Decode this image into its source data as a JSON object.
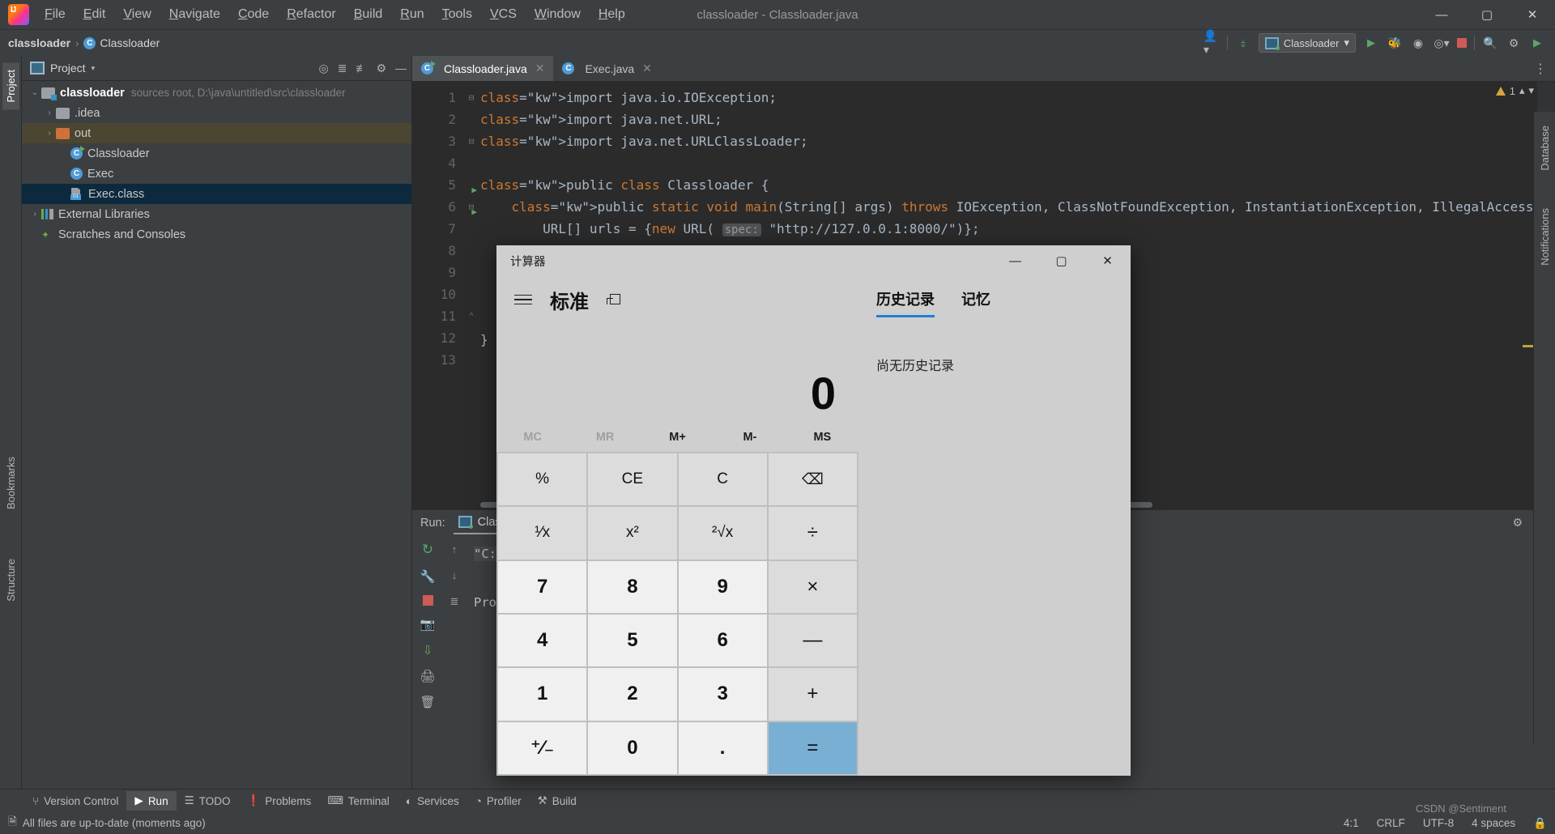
{
  "window": {
    "title": "classloader - Classloader.java",
    "menu": [
      "File",
      "Edit",
      "View",
      "Navigate",
      "Code",
      "Refactor",
      "Build",
      "Run",
      "Tools",
      "VCS",
      "Window",
      "Help"
    ],
    "controls": {
      "minimize": "—",
      "maximize": "▢",
      "close": "✕"
    }
  },
  "navbar": {
    "breadcrumb": [
      "classloader",
      "Classloader"
    ],
    "separator": "›",
    "run_config": "Classloader",
    "run_config_caret": "▾",
    "icons": [
      "user-dropdown-icon",
      "build-hammer-icon",
      "run-icon",
      "debug-icon",
      "coverage-icon",
      "profile-icon",
      "stop-icon",
      "search-icon",
      "settings-icon",
      "run-play-icon"
    ]
  },
  "left_rail": {
    "tabs": [
      "Project",
      "Bookmarks",
      "Structure"
    ]
  },
  "right_rail": {
    "tabs": [
      "Database",
      "Notifications"
    ]
  },
  "project": {
    "panel_title": "Project",
    "header_icons": [
      "locate-icon",
      "expand-all-icon",
      "collapse-all-icon",
      "gear-icon",
      "hide-icon"
    ],
    "tree": [
      {
        "indent": 0,
        "arrow": "⌄",
        "icon": "module-folder-icon",
        "label": "classloader",
        "bold": true,
        "detail": "sources root,  D:\\java\\untitled\\src\\classloader",
        "state": "normal"
      },
      {
        "indent": 1,
        "arrow": "›",
        "icon": "folder-icon",
        "label": ".idea",
        "bold": false,
        "detail": "",
        "state": "normal"
      },
      {
        "indent": 1,
        "arrow": "›",
        "icon": "folder-orange-icon",
        "label": "out",
        "bold": false,
        "detail": "",
        "state": "highlight"
      },
      {
        "indent": 2,
        "arrow": "",
        "icon": "java-class-run-icon",
        "label": "Classloader",
        "bold": false,
        "detail": "",
        "state": "normal"
      },
      {
        "indent": 2,
        "arrow": "",
        "icon": "java-class-icon",
        "label": "Exec",
        "bold": false,
        "detail": "",
        "state": "normal"
      },
      {
        "indent": 2,
        "arrow": "",
        "icon": "class-file-icon",
        "label": "Exec.class",
        "bold": false,
        "detail": "",
        "state": "selected"
      },
      {
        "indent": 0,
        "arrow": "›",
        "icon": "library-icon",
        "label": "External Libraries",
        "bold": false,
        "detail": "",
        "state": "normal"
      },
      {
        "indent": 0,
        "arrow": "",
        "icon": "scratches-icon",
        "label": "Scratches and Consoles",
        "bold": false,
        "detail": "",
        "state": "normal"
      }
    ]
  },
  "editor": {
    "tabs": [
      {
        "label": "Classloader.java",
        "icon": "java-class-run-icon",
        "active": true,
        "close": "✕"
      },
      {
        "label": "Exec.java",
        "icon": "java-class-icon",
        "active": false,
        "close": "✕"
      }
    ],
    "warning_count": "1",
    "warning_icon": "warning-triangle-icon",
    "lines": [
      {
        "n": "1",
        "fold": "⊟",
        "run": "",
        "text": "import java.io.IOException;"
      },
      {
        "n": "2",
        "fold": "",
        "run": "",
        "text": "import java.net.URL;"
      },
      {
        "n": "3",
        "fold": "⊟",
        "run": "",
        "text": "import java.net.URLClassLoader;"
      },
      {
        "n": "4",
        "fold": "",
        "run": "",
        "text": ""
      },
      {
        "n": "5",
        "fold": "",
        "run": "▶",
        "text": "public class Classloader {"
      },
      {
        "n": "6",
        "fold": "⊟",
        "run": "▶",
        "text": "    public static void main(String[] args) throws IOException, ClassNotFoundException, InstantiationException, IllegalAccessExcepti"
      },
      {
        "n": "7",
        "fold": "",
        "run": "",
        "text": "        URL[] urls = {new URL( spec: \"http://127.0.0.1:8000/\")};"
      },
      {
        "n": "8",
        "fold": "",
        "run": "",
        "text": ""
      },
      {
        "n": "9",
        "fold": "",
        "run": "",
        "text": ""
      },
      {
        "n": "10",
        "fold": "",
        "run": "",
        "text": ""
      },
      {
        "n": "11",
        "fold": "⌃",
        "run": "",
        "text": ""
      },
      {
        "n": "12",
        "fold": "",
        "run": "",
        "text": "}"
      },
      {
        "n": "13",
        "fold": "",
        "run": "",
        "text": ""
      }
    ],
    "param_hint": "spec:",
    "string_literal": "\"http://127.0.0.1:8000/\""
  },
  "run_panel": {
    "label": "Run:",
    "tab": "Classloader",
    "tab_close": "✕",
    "console": [
      "\"C:\\Program Files\\Java\\jdk1.8.0_251\\bin\\java.exe\"",
      "",
      "Process finished with exit code 0"
    ],
    "header_icons": [
      "settings-icon",
      "hide-icon"
    ],
    "rail_icons": [
      "rerun-icon",
      "wrench-icon",
      "stop-icon",
      "screenshot-icon",
      "scroll-down-icon",
      "print-icon",
      "trash-icon"
    ],
    "rail2_icons": [
      "up-arrow-icon",
      "down-arrow-icon",
      "soft-wrap-icon"
    ]
  },
  "tool_windows": [
    {
      "label": "Version Control",
      "icon": "branch-icon",
      "active": false
    },
    {
      "label": "Run",
      "icon": "play-icon",
      "active": true
    },
    {
      "label": "TODO",
      "icon": "list-icon",
      "active": false
    },
    {
      "label": "Problems",
      "icon": "exclamation-icon",
      "active": false
    },
    {
      "label": "Terminal",
      "icon": "terminal-icon",
      "active": false
    },
    {
      "label": "Services",
      "icon": "services-icon",
      "active": false
    },
    {
      "label": "Profiler",
      "icon": "profiler-icon",
      "active": false
    },
    {
      "label": "Build",
      "icon": "hammer-icon",
      "active": false
    }
  ],
  "status_bar": {
    "message": "All files are up-to-date (moments ago)",
    "message_icon": "document-icon",
    "caret": "4:1",
    "line_sep": "CRLF",
    "encoding": "UTF-8",
    "indent": "4 spaces",
    "lock_icon": "lock-icon",
    "watermark": "CSDN @Sentiment"
  },
  "calculator": {
    "title": "计算器",
    "controls": {
      "minimize": "—",
      "maximize": "▢",
      "close": "✕"
    },
    "mode": "标准",
    "menu_icon": "hamburger-icon",
    "keep_on_top_icon": "keep-on-top-icon",
    "display_value": "0",
    "memory_buttons": [
      {
        "label": "MC",
        "disabled": true
      },
      {
        "label": "MR",
        "disabled": true
      },
      {
        "label": "M+",
        "disabled": false
      },
      {
        "label": "M-",
        "disabled": false
      },
      {
        "label": "MS",
        "disabled": false
      }
    ],
    "keys": [
      {
        "label": "%",
        "kind": "fn",
        "name": "percent"
      },
      {
        "label": "CE",
        "kind": "fn",
        "name": "clear-entry"
      },
      {
        "label": "C",
        "kind": "fn",
        "name": "clear"
      },
      {
        "label": "⌫",
        "kind": "fn",
        "name": "backspace"
      },
      {
        "label": "¹⁄x",
        "kind": "fn",
        "name": "reciprocal"
      },
      {
        "label": "x²",
        "kind": "fn",
        "name": "square"
      },
      {
        "label": "²√x",
        "kind": "fn",
        "name": "square-root"
      },
      {
        "label": "÷",
        "kind": "op",
        "name": "divide"
      },
      {
        "label": "7",
        "kind": "num",
        "name": "seven"
      },
      {
        "label": "8",
        "kind": "num",
        "name": "eight"
      },
      {
        "label": "9",
        "kind": "num",
        "name": "nine"
      },
      {
        "label": "×",
        "kind": "op",
        "name": "multiply"
      },
      {
        "label": "4",
        "kind": "num",
        "name": "four"
      },
      {
        "label": "5",
        "kind": "num",
        "name": "five"
      },
      {
        "label": "6",
        "kind": "num",
        "name": "six"
      },
      {
        "label": "—",
        "kind": "op",
        "name": "subtract"
      },
      {
        "label": "1",
        "kind": "num",
        "name": "one"
      },
      {
        "label": "2",
        "kind": "num",
        "name": "two"
      },
      {
        "label": "3",
        "kind": "num",
        "name": "three"
      },
      {
        "label": "+",
        "kind": "op",
        "name": "add"
      },
      {
        "label": "⁺⁄₋",
        "kind": "num",
        "name": "negate"
      },
      {
        "label": "0",
        "kind": "num",
        "name": "zero"
      },
      {
        "label": ".",
        "kind": "num",
        "name": "decimal"
      },
      {
        "label": "=",
        "kind": "eq",
        "name": "equals"
      }
    ],
    "history": {
      "tabs": [
        {
          "label": "历史记录",
          "active": true
        },
        {
          "label": "记忆",
          "active": false
        }
      ],
      "empty_text": "尚无历史记录"
    }
  },
  "colors": {
    "accent_blue": "#1f7fd4",
    "ide_bg": "#3c3f41",
    "editor_bg": "#2b2b2b",
    "selection": "#0d293e",
    "calc_bg": "#cfcfcf",
    "equals_blue": "#7aafd4"
  }
}
